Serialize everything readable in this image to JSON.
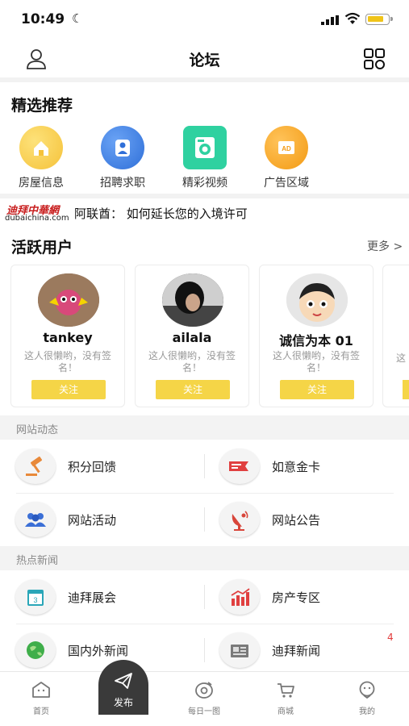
{
  "status": {
    "time": "10:49"
  },
  "nav": {
    "title": "论坛"
  },
  "featured": {
    "title": "精选推荐",
    "items": [
      {
        "label": "房屋信息",
        "icon": "house-icon",
        "color": "#f5c23a"
      },
      {
        "label": "招聘求职",
        "icon": "person-icon",
        "color": "#3b7de3"
      },
      {
        "label": "精彩视频",
        "icon": "video-icon",
        "color": "#2fcf9e"
      },
      {
        "label": "广告区域",
        "icon": "ad-icon",
        "color": "#f5a623"
      }
    ]
  },
  "ticker": {
    "logo_cn": "迪拜中華網",
    "logo_en": "dubaichina.com",
    "text": "阿联酋：  如何延长您的入境许可"
  },
  "active_users": {
    "title": "活跃用户",
    "more": "更多 >",
    "users": [
      {
        "name": "tankey",
        "bio": "这人很懒哟，没有签名！",
        "follow": "关注"
      },
      {
        "name": "ailala",
        "bio": "这人很懒哟，没有签名！",
        "follow": "关注"
      },
      {
        "name": "诚信为本 01",
        "bio": "这人很懒哟，没有签名！",
        "follow": "关注"
      }
    ]
  },
  "site_news": {
    "title": "网站动态",
    "items": [
      {
        "label": "积分回馈",
        "icon": "gavel-icon"
      },
      {
        "label": "如意金卡",
        "icon": "card-icon"
      },
      {
        "label": "网站活动",
        "icon": "group-icon"
      },
      {
        "label": "网站公告",
        "icon": "satellite-icon"
      }
    ]
  },
  "hot_news": {
    "title": "热点新闻",
    "items": [
      {
        "label": "迪拜展会",
        "icon": "calendar-icon"
      },
      {
        "label": "房产专区",
        "icon": "bar-chart-icon"
      },
      {
        "label": "国内外新闻",
        "icon": "globe-icon"
      },
      {
        "label": "迪拜新闻",
        "icon": "newspaper-icon",
        "badge": "4"
      }
    ]
  },
  "tabbar": {
    "tabs": [
      {
        "label": "首页",
        "icon": "home-icon"
      },
      {
        "label": "发布",
        "icon": "send-icon"
      },
      {
        "label": "每日一图",
        "icon": "camera-icon"
      },
      {
        "label": "商城",
        "icon": "cart-icon"
      },
      {
        "label": "我的",
        "icon": "profile-icon"
      }
    ]
  }
}
